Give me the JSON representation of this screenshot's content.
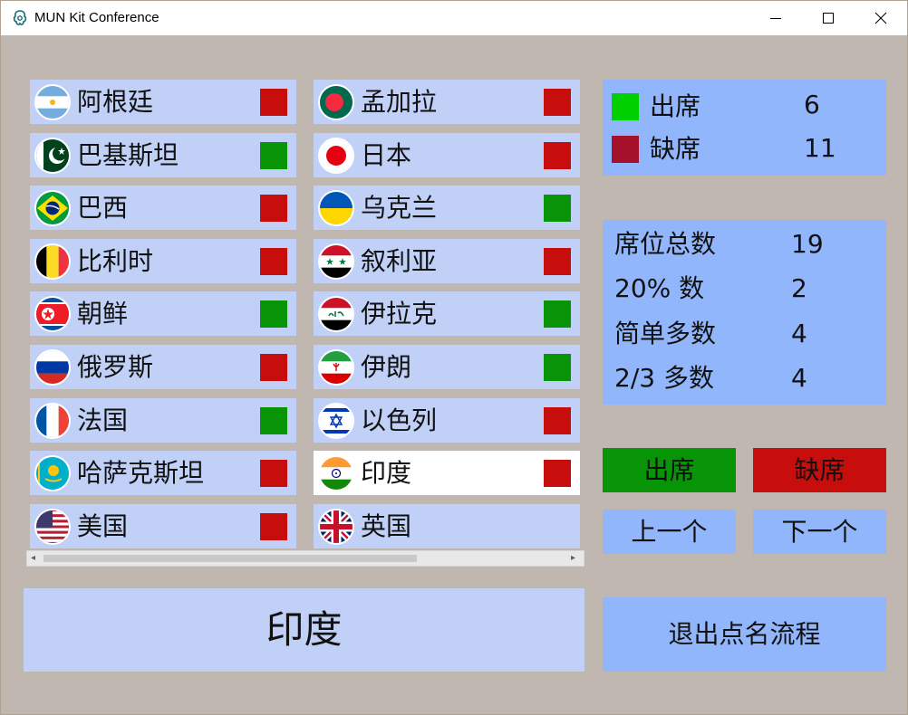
{
  "window": {
    "title": "MUN Kit Conference"
  },
  "colors": {
    "present": "#079507",
    "absent": "#c80d0d",
    "row_bg": "#c0d0f6",
    "panel_bg": "#91b6fb",
    "present_legend": "#00d000",
    "absent_legend": "#a5112b"
  },
  "countries": [
    {
      "name": "阿根廷",
      "flag": "argentina",
      "status": "absent"
    },
    {
      "name": "巴基斯坦",
      "flag": "pakistan",
      "status": "present"
    },
    {
      "name": "巴西",
      "flag": "brazil",
      "status": "absent"
    },
    {
      "name": "比利时",
      "flag": "belgium",
      "status": "absent"
    },
    {
      "name": "朝鲜",
      "flag": "north-korea",
      "status": "present"
    },
    {
      "name": "俄罗斯",
      "flag": "russia",
      "status": "absent"
    },
    {
      "name": "法国",
      "flag": "france",
      "status": "present"
    },
    {
      "name": "哈萨克斯坦",
      "flag": "kazakhstan",
      "status": "absent"
    },
    {
      "name": "美国",
      "flag": "usa",
      "status": "absent"
    },
    {
      "name": "孟加拉",
      "flag": "bangladesh",
      "status": "absent"
    },
    {
      "name": "日本",
      "flag": "japan",
      "status": "absent"
    },
    {
      "name": "乌克兰",
      "flag": "ukraine",
      "status": "present"
    },
    {
      "name": "叙利亚",
      "flag": "syria",
      "status": "absent"
    },
    {
      "name": "伊拉克",
      "flag": "iraq",
      "status": "present"
    },
    {
      "name": "伊朗",
      "flag": "iran",
      "status": "present"
    },
    {
      "name": "以色列",
      "flag": "israel",
      "status": "absent"
    },
    {
      "name": "印度",
      "flag": "india",
      "status": "absent",
      "selected": true
    },
    {
      "name": "英国",
      "flag": "uk",
      "status": "none"
    }
  ],
  "attendance": {
    "present_label": "出席",
    "present_count": "6",
    "absent_label": "缺席",
    "absent_count": "11"
  },
  "stats": [
    {
      "label": "席位总数",
      "value": "19"
    },
    {
      "label": "20% 数",
      "value": "2"
    },
    {
      "label": "简单多数",
      "value": "4"
    },
    {
      "label": "2/3 多数",
      "value": "4"
    }
  ],
  "buttons": {
    "present": "出席",
    "absent": "缺席",
    "prev": "上一个",
    "next": "下一个",
    "exit": "退出点名流程"
  },
  "selected_country": "印度"
}
